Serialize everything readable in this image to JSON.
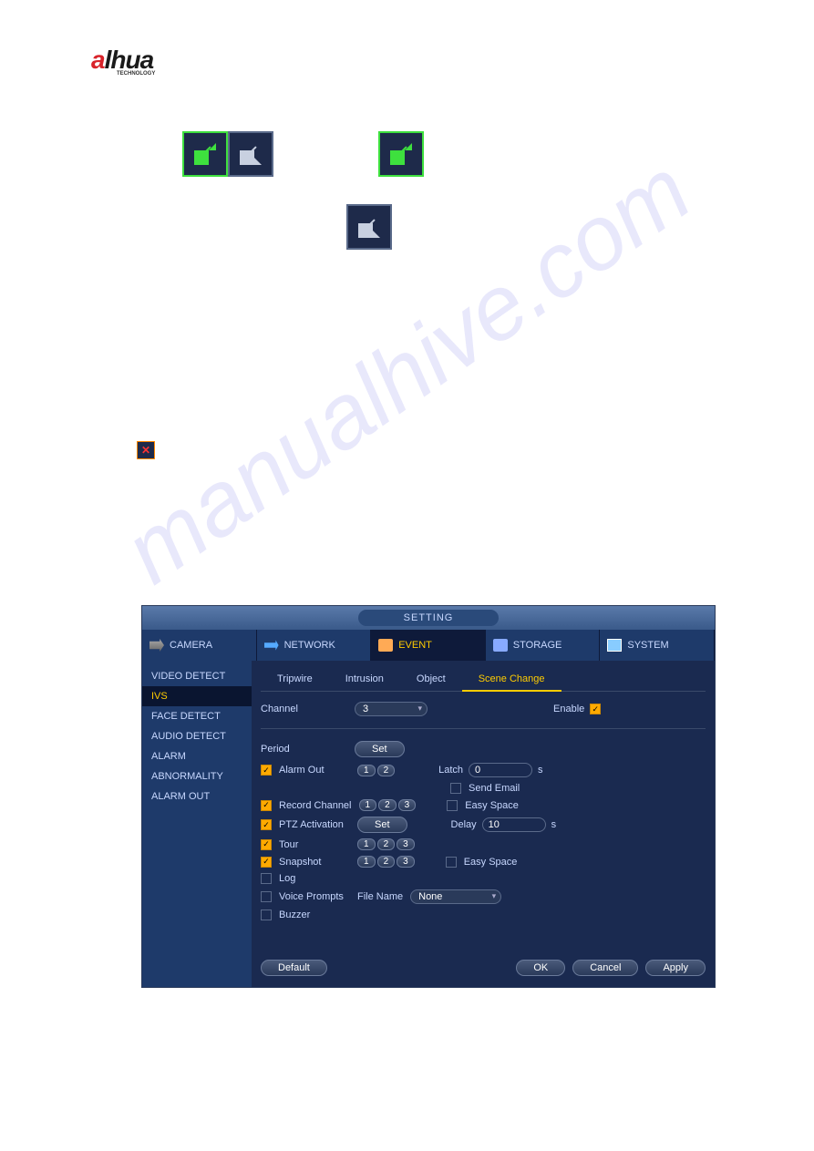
{
  "logo": {
    "brand_a": "a",
    "brand_rest": "lhua",
    "sub": "TECHNOLOGY"
  },
  "watermark": "manualhive.com",
  "delete_icon_glyph": "✕",
  "app": {
    "title": "SETTING",
    "top_tabs": [
      {
        "label": "CAMERA"
      },
      {
        "label": "NETWORK"
      },
      {
        "label": "EVENT"
      },
      {
        "label": "STORAGE"
      },
      {
        "label": "SYSTEM"
      }
    ],
    "sidebar": [
      "VIDEO DETECT",
      "IVS",
      "FACE DETECT",
      "AUDIO DETECT",
      "ALARM",
      "ABNORMALITY",
      "ALARM OUT"
    ],
    "sub_tabs": [
      "Tripwire",
      "Intrusion",
      "Object",
      "Scene Change"
    ],
    "channel": {
      "label": "Channel",
      "value": "3"
    },
    "enable": {
      "label": "Enable"
    },
    "period": {
      "label": "Period",
      "btn": "Set"
    },
    "alarm_out": {
      "label": "Alarm Out",
      "nums": [
        "1",
        "2"
      ]
    },
    "latch": {
      "label": "Latch",
      "value": "0",
      "suffix": "s"
    },
    "send_email": {
      "label": "Send Email"
    },
    "record_channel": {
      "label": "Record Channel",
      "nums": [
        "1",
        "2",
        "3"
      ]
    },
    "easy_space": {
      "label": "Easy Space"
    },
    "ptz": {
      "label": "PTZ Activation",
      "btn": "Set"
    },
    "delay": {
      "label": "Delay",
      "value": "10",
      "suffix": "s"
    },
    "tour": {
      "label": "Tour",
      "nums": [
        "1",
        "2",
        "3"
      ]
    },
    "snapshot": {
      "label": "Snapshot",
      "nums": [
        "1",
        "2",
        "3"
      ]
    },
    "easy_space2": {
      "label": "Easy Space"
    },
    "log": {
      "label": "Log"
    },
    "voice": {
      "label": "Voice Prompts",
      "file_label": "File Name",
      "file_value": "None"
    },
    "buzzer": {
      "label": "Buzzer"
    },
    "footer": {
      "default": "Default",
      "ok": "OK",
      "cancel": "Cancel",
      "apply": "Apply"
    }
  }
}
